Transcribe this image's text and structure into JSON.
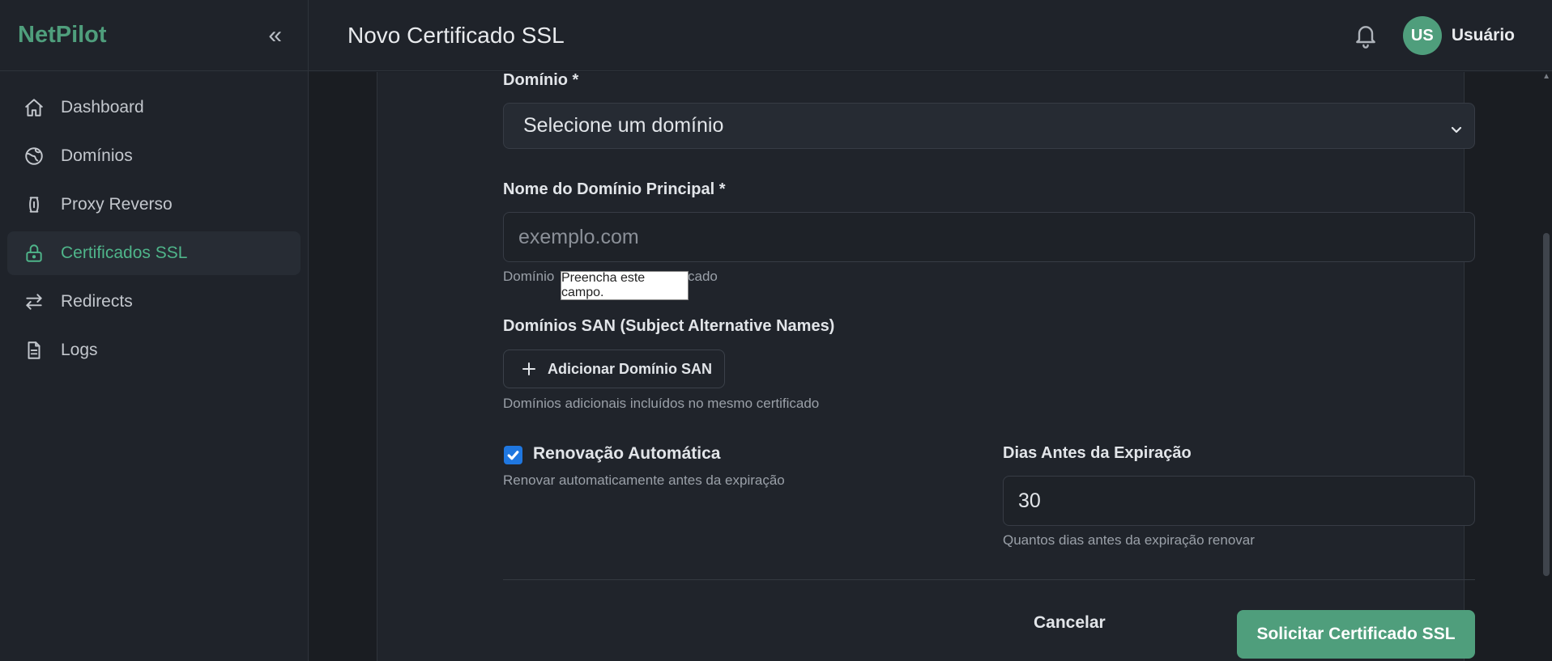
{
  "app": {
    "brand": "NetPilot"
  },
  "sidebar": {
    "items": [
      {
        "label": "Dashboard",
        "icon": "home-icon"
      },
      {
        "label": "Domínios",
        "icon": "globe-icon"
      },
      {
        "label": "Proxy Reverso",
        "icon": "proxy-icon"
      },
      {
        "label": "Certificados SSL",
        "icon": "lock-icon",
        "active": true
      },
      {
        "label": "Redirects",
        "icon": "arrows-icon"
      },
      {
        "label": "Logs",
        "icon": "file-icon"
      }
    ]
  },
  "header": {
    "title": "Novo Certificado SSL",
    "user_initials": "US",
    "user_name": "Usuário"
  },
  "form": {
    "domain": {
      "label": "Domínio *",
      "value": "Selecione um domínio"
    },
    "main_domain": {
      "label": "Nome do Domínio Principal *",
      "placeholder": "exemplo.com",
      "help_left": "Domínio",
      "help_right": "cado",
      "tooltip": "Preencha este campo."
    },
    "san": {
      "label": "Domínios SAN (Subject Alternative Names)",
      "add_button": "Adicionar Domínio SAN",
      "help": "Domínios adicionais incluídos no mesmo certificado"
    },
    "auto_renew": {
      "label": "Renovação Automática",
      "checked": true,
      "help": "Renovar automaticamente antes da expiração"
    },
    "days_before": {
      "label": "Dias Antes da Expiração",
      "value": "30",
      "help": "Quantos dias antes da expiração renovar"
    },
    "cancel_label": "Cancelar",
    "submit_label": "Solicitar Certificado SSL"
  },
  "colors": {
    "accent": "#4f9e7c",
    "checkbox": "#1f77e0"
  }
}
